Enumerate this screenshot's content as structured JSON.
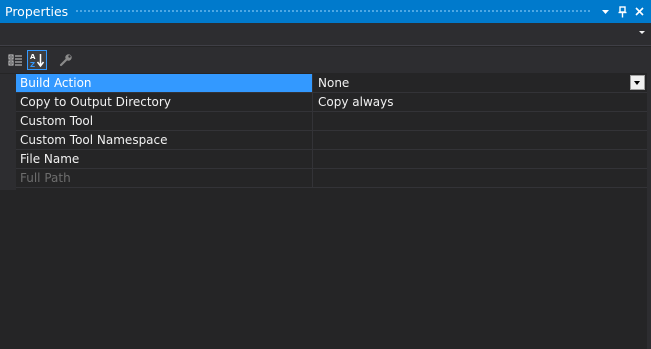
{
  "window": {
    "title": "Properties",
    "buttons": [
      {
        "name": "window-position-dropdown-button",
        "icon": "dropdown-arrow-icon",
        "glyph": "▾"
      },
      {
        "name": "pin-button",
        "icon": "pin-icon",
        "glyph": "⊥"
      },
      {
        "name": "close-button",
        "icon": "close-icon",
        "glyph": "✕"
      }
    ]
  },
  "toolbar": {
    "buttons": [
      {
        "name": "categorized-button",
        "icon": "categorized-icon",
        "active": false
      },
      {
        "name": "alphabetical-button",
        "icon": "sort-alphabetical-icon",
        "active": true
      },
      {
        "name": "property-pages-button",
        "icon": "wrench-icon",
        "active": false
      }
    ]
  },
  "properties": [
    {
      "name": "Build Action",
      "value": "None",
      "selected": true,
      "disabled": false,
      "has_dropdown": true
    },
    {
      "name": "Copy to Output Directory",
      "value": "Copy always",
      "selected": false,
      "disabled": false,
      "has_dropdown": false
    },
    {
      "name": "Custom Tool",
      "value": "",
      "selected": false,
      "disabled": false,
      "has_dropdown": false
    },
    {
      "name": "Custom Tool Namespace",
      "value": "",
      "selected": false,
      "disabled": false,
      "has_dropdown": false
    },
    {
      "name": "File Name",
      "value": "",
      "selected": false,
      "disabled": false,
      "has_dropdown": false
    },
    {
      "name": "Full Path",
      "value": "",
      "selected": false,
      "disabled": true,
      "has_dropdown": false
    }
  ],
  "colors": {
    "accent": "#007acc",
    "selection": "#3399ff",
    "background": "#252526"
  }
}
